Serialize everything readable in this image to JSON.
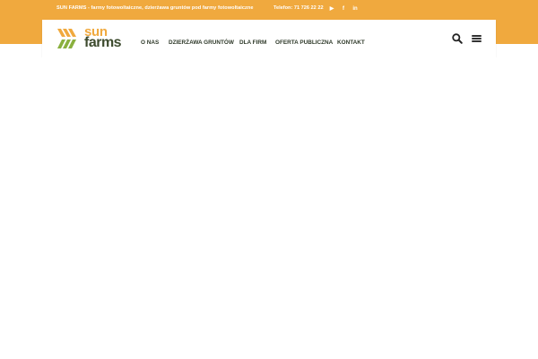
{
  "topbar": {
    "tagline": "SUN FARMS - farmy fotowoltaiczne, dzierżawa gruntów pod farmy fotowoltaiczne",
    "phone": "Telefon: 71 726 22 22",
    "social": [
      {
        "icon": "youtube-icon",
        "glyph": "▶"
      },
      {
        "icon": "facebook-icon",
        "glyph": "f"
      },
      {
        "icon": "linkedin-icon",
        "glyph": "in"
      }
    ],
    "background_color": "#f0a93e"
  },
  "logo": {
    "word_top": "sun",
    "word_bottom": "farms",
    "accent_color": "#f0a93e",
    "dark_color": "#3d4b2e"
  },
  "nav": {
    "items": [
      {
        "label": "O NAS"
      },
      {
        "label": "DZIERŻAWA GRUNTÓW"
      },
      {
        "label": "DLA FIRM"
      },
      {
        "label": "OFERTA PUBLICZNA"
      },
      {
        "label": "KONTAKT"
      }
    ],
    "search_icon": "search-icon",
    "menu_icon": "hamburger-menu-icon"
  }
}
